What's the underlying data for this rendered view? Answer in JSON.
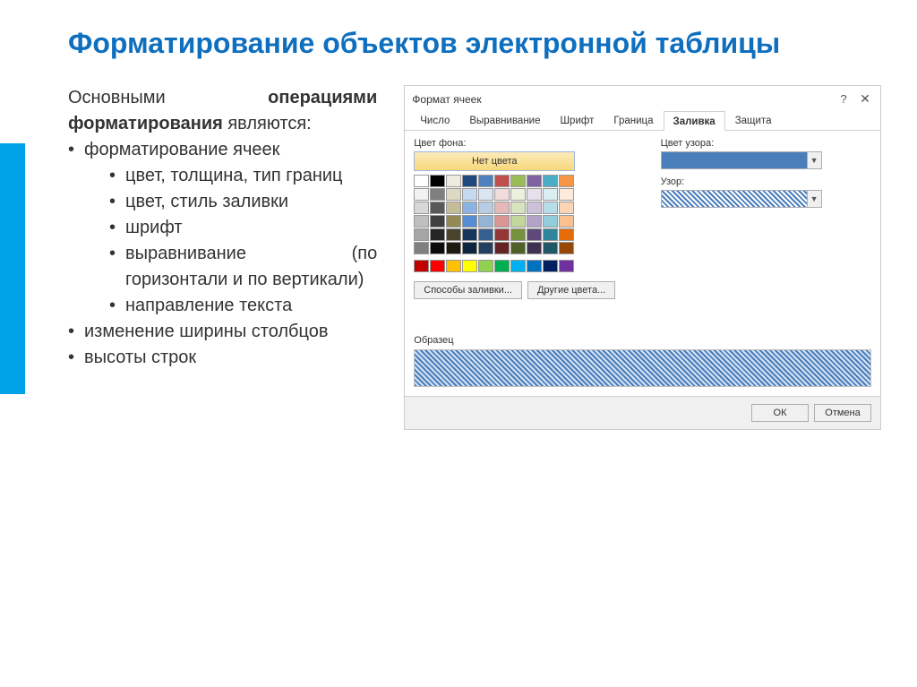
{
  "slide": {
    "title": "Форматирование объектов электронной таблицы",
    "intro_prefix": "Основными",
    "intro_bold": "операциями форматирования",
    "intro_suffix": " являются:",
    "bullets": {
      "b1": "форматирование ячеек",
      "b1_sub": [
        "цвет, толщина, тип границ",
        "цвет, стиль заливки",
        "шрифт",
        "выравнивание (по горизонтали и по вертикали)",
        "направление текста"
      ],
      "b2": "изменение ширины столбцов",
      "b3": "высоты строк"
    }
  },
  "dialog": {
    "title": "Формат ячеек",
    "tabs": [
      "Число",
      "Выравнивание",
      "Шрифт",
      "Граница",
      "Заливка",
      "Защита"
    ],
    "active_tab": "Заливка",
    "labels": {
      "bgcolor": "Цвет фона:",
      "nocolor": "Нет цвета",
      "pattern_color": "Цвет узора:",
      "pattern": "Узор:",
      "fill_methods": "Способы заливки...",
      "other_colors": "Другие цвета...",
      "sample": "Образец",
      "ok": "ОК",
      "cancel": "Отмена"
    },
    "palette_rows": [
      [
        "#ffffff",
        "#000000",
        "#eeece1",
        "#1f497d",
        "#4f81bd",
        "#c0504d",
        "#9bbb59",
        "#8064a2",
        "#4bacc6",
        "#f79646"
      ],
      [
        "#f2f2f2",
        "#7f7f7f",
        "#ddd9c3",
        "#c6d9f0",
        "#dbe5f1",
        "#f2dcdb",
        "#ebf1dd",
        "#e5e0ec",
        "#dbeef3",
        "#fdeada"
      ],
      [
        "#d8d8d8",
        "#595959",
        "#c4bd97",
        "#8db3e2",
        "#b8cce4",
        "#e5b9b7",
        "#d7e3bc",
        "#ccc1d9",
        "#b7dde8",
        "#fbd5b5"
      ],
      [
        "#bfbfbf",
        "#3f3f3f",
        "#938953",
        "#548dd4",
        "#95b3d7",
        "#d99694",
        "#c3d69b",
        "#b2a2c7",
        "#92cddc",
        "#fac08f"
      ],
      [
        "#a5a5a5",
        "#262626",
        "#494429",
        "#17365d",
        "#366092",
        "#953734",
        "#76923c",
        "#5f497a",
        "#31859b",
        "#e36c09"
      ],
      [
        "#7f7f7f",
        "#0c0c0c",
        "#1d1b10",
        "#0f243e",
        "#244061",
        "#632423",
        "#4f6128",
        "#3f3151",
        "#205867",
        "#974806"
      ],
      [
        "#c00000",
        "#ff0000",
        "#ffc000",
        "#ffff00",
        "#92d050",
        "#00b050",
        "#00b0f0",
        "#0070c0",
        "#002060",
        "#7030a0"
      ]
    ]
  }
}
